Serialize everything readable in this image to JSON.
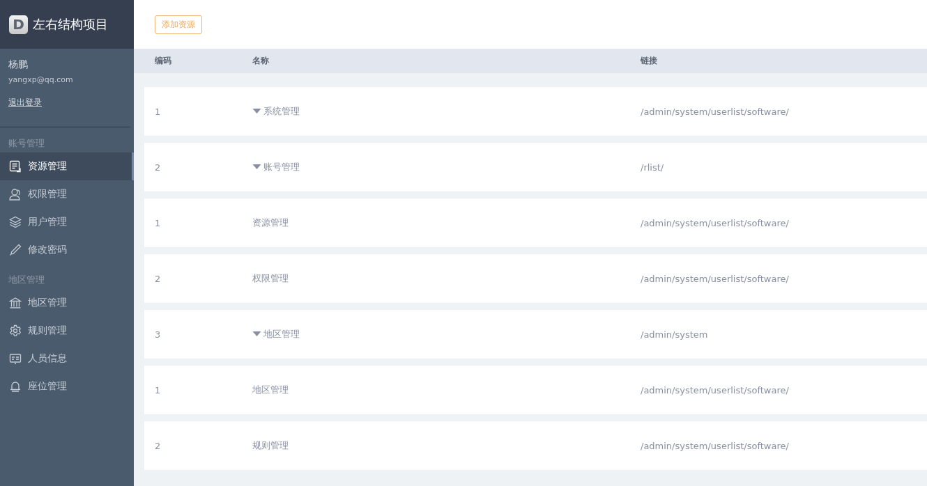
{
  "app": {
    "logo_letter": "D",
    "title": "左右结构项目"
  },
  "user": {
    "name": "杨鹏",
    "email": "yangxp@qq.com",
    "logout": "退出登录"
  },
  "sidebar": {
    "sections": [
      {
        "label": "账号管理",
        "items": [
          {
            "label": "资源管理",
            "kind": "document",
            "selected": true
          },
          {
            "label": "权限管理",
            "kind": "user",
            "selected": false
          },
          {
            "label": "用户管理",
            "kind": "layers",
            "selected": false
          },
          {
            "label": "修改密码",
            "kind": "pen",
            "selected": false
          }
        ]
      },
      {
        "label": "地区管理",
        "items": [
          {
            "label": "地区管理",
            "kind": "building",
            "selected": false
          },
          {
            "label": "规则管理",
            "kind": "gear",
            "selected": false
          },
          {
            "label": "人员信息",
            "kind": "card",
            "selected": false
          },
          {
            "label": "座位管理",
            "kind": "bell",
            "selected": false
          }
        ]
      }
    ]
  },
  "toolbar": {
    "add_button": "添加资源"
  },
  "table": {
    "columns": [
      "编码",
      "名称",
      "链接"
    ],
    "rows": [
      {
        "kind": "group",
        "expanded": true,
        "code": "1",
        "name": "系统管理",
        "link": "/admin/system/userlist/software/"
      },
      {
        "kind": "group",
        "expanded": true,
        "code": "2",
        "name": "账号管理",
        "link": "/rlist/"
      },
      {
        "kind": "leaf",
        "code": "1",
        "name": "资源管理",
        "link": "/admin/system/userlist/software/"
      },
      {
        "kind": "leaf",
        "code": "2",
        "name": "权限管理",
        "link": "/admin/system/userlist/software/"
      },
      {
        "kind": "group",
        "expanded": true,
        "code": "3",
        "name": "地区管理",
        "link": "/admin/system"
      },
      {
        "kind": "leaf",
        "code": "1",
        "name": "地区管理",
        "link": "/admin/system/userlist/software/"
      },
      {
        "kind": "leaf",
        "code": "2",
        "name": "规则管理",
        "link": "/admin/system/userlist/software/"
      }
    ]
  }
}
